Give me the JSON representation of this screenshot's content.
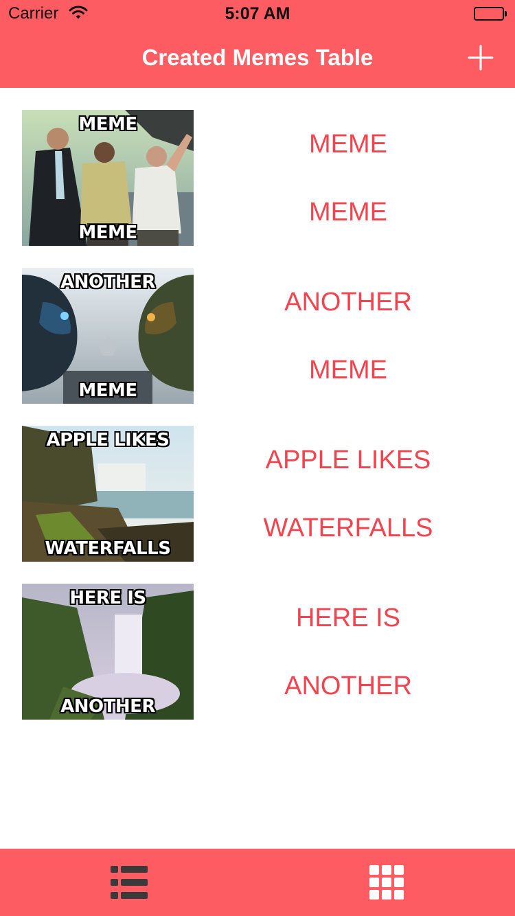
{
  "status_bar": {
    "carrier": "Carrier",
    "time": "5:07 AM"
  },
  "nav": {
    "title": "Created Memes Table",
    "add_icon": "plus-icon"
  },
  "memes": [
    {
      "top": "MEME",
      "bottom": "MEME",
      "image": "gta-characters"
    },
    {
      "top": "ANOTHER",
      "bottom": "MEME",
      "image": "halo-helmets"
    },
    {
      "top": "APPLE LIKES",
      "bottom": "WATERFALLS",
      "image": "waterfall-cliff"
    },
    {
      "top": "HERE IS",
      "bottom": "ANOTHER",
      "image": "waterfall-valley"
    }
  ],
  "tab_bar": {
    "tabs": [
      {
        "icon": "list-icon",
        "selected": true
      },
      {
        "icon": "grid-icon",
        "selected": false
      }
    ]
  },
  "colors": {
    "accent": "#fd5c63",
    "text": "#f2444f",
    "selected_tab_icon": "#3a3a3a",
    "unselected_tab_icon": "#ffffff"
  }
}
